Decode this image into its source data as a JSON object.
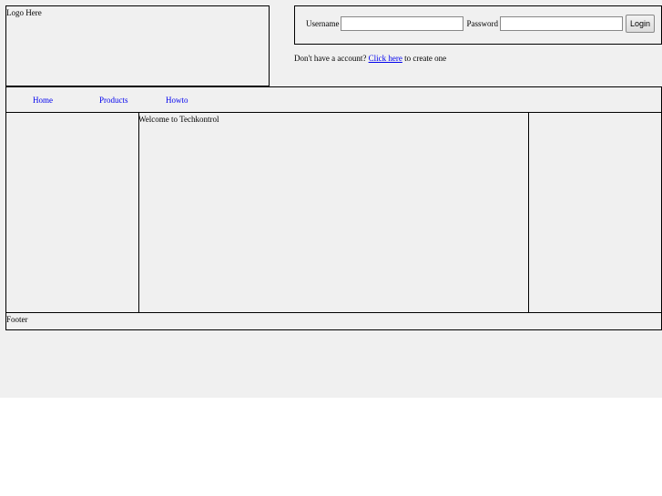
{
  "header": {
    "logo_text": "Logo Here"
  },
  "login": {
    "username_label": "Username",
    "username_value": "",
    "password_label": "Password",
    "password_value": "",
    "button_label": "Login"
  },
  "signup": {
    "prefix": "Don't have a account?",
    "link_text": "Click here",
    "suffix": "to create one"
  },
  "nav": {
    "items": [
      {
        "label": "Home"
      },
      {
        "label": "Products"
      },
      {
        "label": "Howto"
      }
    ]
  },
  "main": {
    "welcome_text": "Welcome to Techkontrol"
  },
  "footer": {
    "text": "Footer"
  },
  "colors": {
    "page_bg": "#f0f0f0",
    "link": "#0000ee",
    "border": "#000000"
  }
}
